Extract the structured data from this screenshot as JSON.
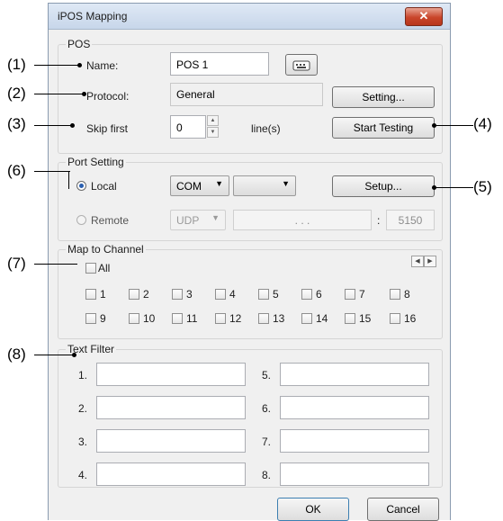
{
  "dialog": {
    "title": "iPOS Mapping",
    "close_glyph": "✕"
  },
  "callouts": [
    "(1)",
    "(2)",
    "(3)",
    "(4)",
    "(5)",
    "(6)",
    "(7)",
    "(8)"
  ],
  "pos": {
    "legend": "POS",
    "name_label": "Name:",
    "name_value": "POS 1",
    "protocol_label": "Protocol:",
    "protocol_value": "General",
    "setting_button": "Setting...",
    "skip_label": "Skip  first",
    "skip_value": "0",
    "lines_label": "line(s)",
    "start_testing_button": "Start Testing",
    "keyboard_icon": "keyboard-icon"
  },
  "port": {
    "legend": "Port Setting",
    "local_label": "Local",
    "local_selected": true,
    "local_type": "COM",
    "local_port": "",
    "setup_button": "Setup...",
    "remote_label": "Remote",
    "remote_type": "UDP",
    "ip_dots": ".      .      .",
    "colon": ":",
    "remote_port": "5150"
  },
  "channels": {
    "legend": "Map to Channel",
    "all_label": "All",
    "items": [
      "1",
      "2",
      "3",
      "4",
      "5",
      "6",
      "7",
      "8",
      "9",
      "10",
      "11",
      "12",
      "13",
      "14",
      "15",
      "16"
    ]
  },
  "filter": {
    "legend": "Text Filter",
    "labels": [
      "1.",
      "2.",
      "3.",
      "4.",
      "5.",
      "6.",
      "7.",
      "8."
    ]
  },
  "footer": {
    "ok": "OK",
    "cancel": "Cancel"
  }
}
